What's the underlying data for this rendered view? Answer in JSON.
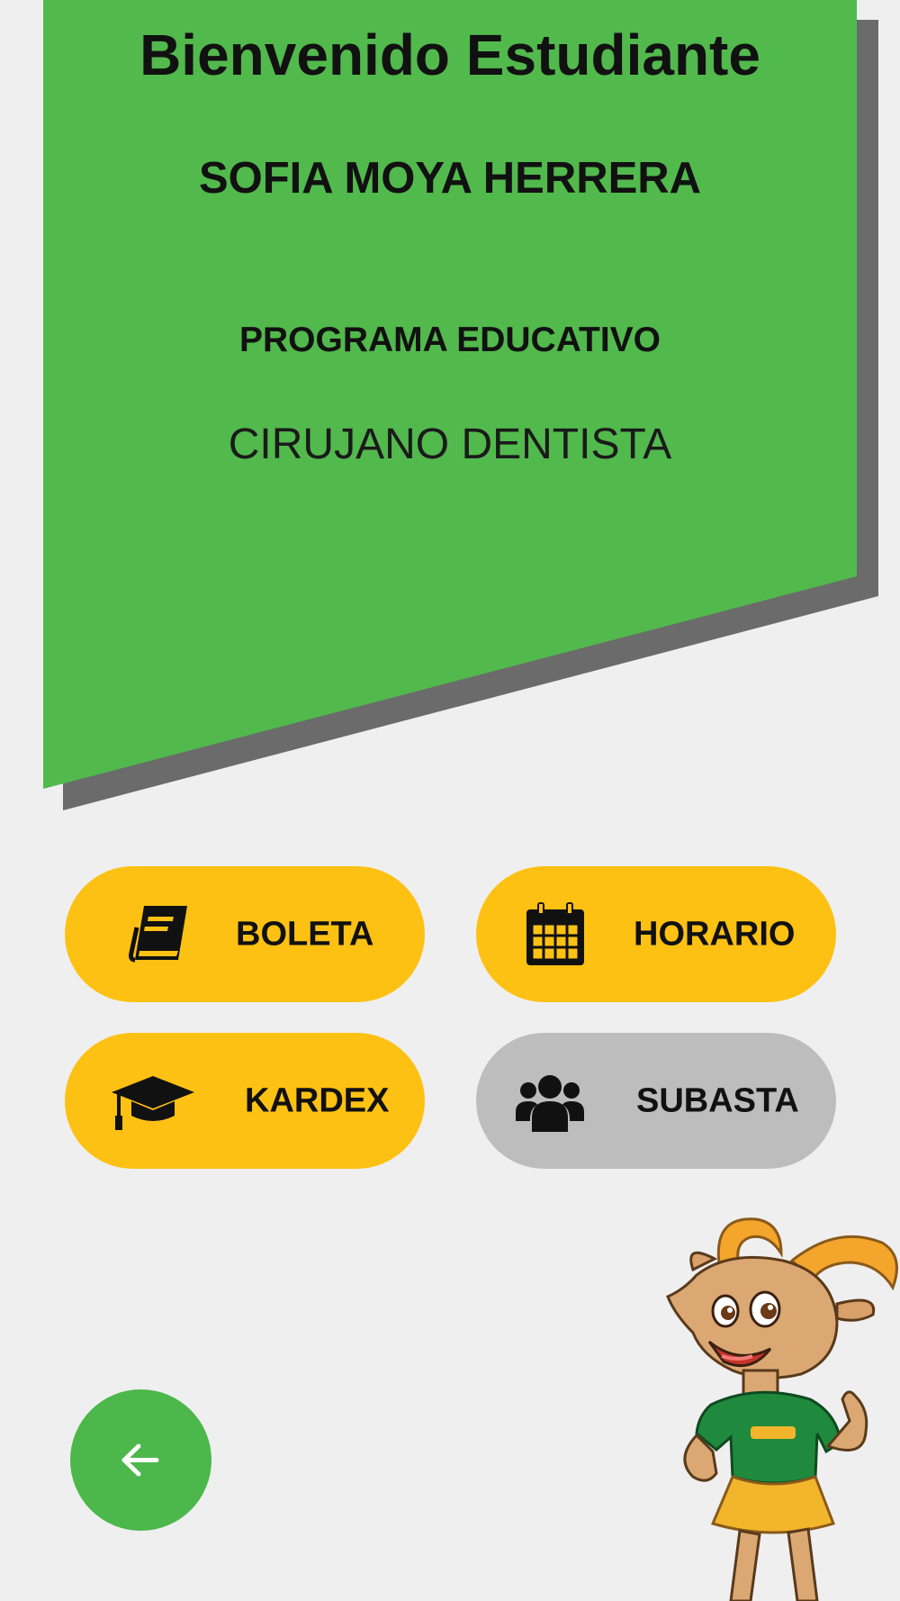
{
  "header": {
    "welcome_title": "Bienvenido Estudiante",
    "student_name": "SOFIA MOYA HERRERA",
    "program_label": "PROGRAMA EDUCATIVO",
    "program_name": "CIRUJANO DENTISTA"
  },
  "menu": {
    "buttons": [
      {
        "label": "BOLETA",
        "icon": "book-icon",
        "enabled": true
      },
      {
        "label": "HORARIO",
        "icon": "calendar-icon",
        "enabled": true
      },
      {
        "label": "KARDEX",
        "icon": "graduation-cap-icon",
        "enabled": true
      },
      {
        "label": "SUBASTA",
        "icon": "users-icon",
        "enabled": false
      }
    ]
  },
  "back_button": {
    "icon": "arrow-left-icon"
  },
  "mascot": {
    "icon": "goat-mascot"
  },
  "colors": {
    "banner_green": "#52b94d",
    "button_yellow": "#fdc113",
    "button_disabled": "#bdbdbd",
    "back_button_green": "#4cb74a",
    "background": "#efeff0",
    "shadow": "#6b6b6b"
  }
}
